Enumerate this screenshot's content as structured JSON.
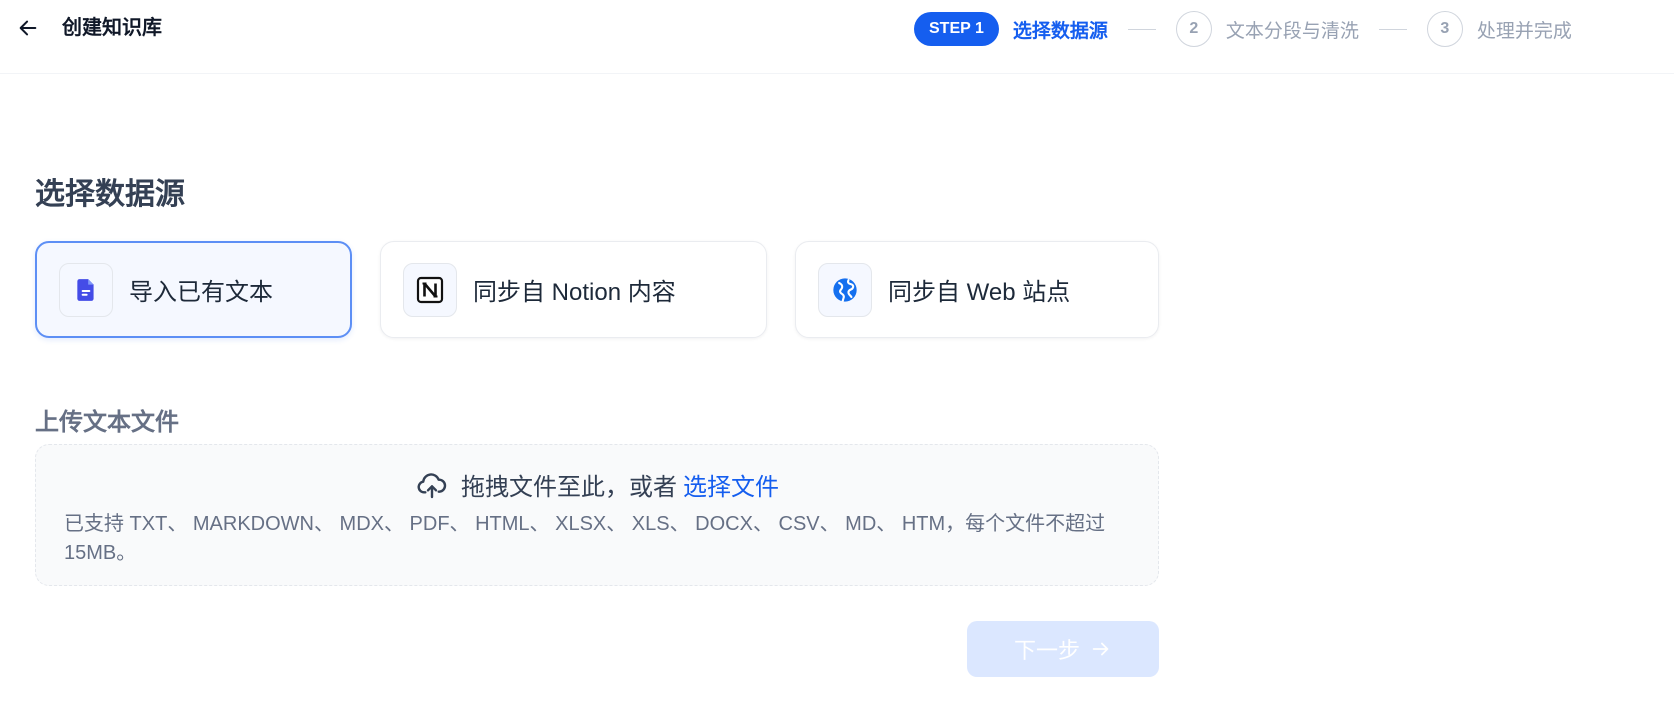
{
  "header": {
    "title": "创建知识库",
    "steps": [
      {
        "badge": "STEP 1",
        "label": "选择数据源",
        "state": "current"
      },
      {
        "badge": "2",
        "label": "文本分段与清洗",
        "state": "pending"
      },
      {
        "badge": "3",
        "label": "处理并完成",
        "state": "pending"
      }
    ]
  },
  "main": {
    "section_title": "选择数据源",
    "sources": [
      {
        "label": "导入已有文本",
        "icon": "file-text-icon",
        "selected": true
      },
      {
        "label": "同步自 Notion 内容",
        "icon": "notion-icon",
        "selected": false
      },
      {
        "label": "同步自 Web 站点",
        "icon": "globe-icon",
        "selected": false
      }
    ],
    "upload": {
      "title": "上传文本文件",
      "drop_text": "拖拽文件至此，或者",
      "select_link": "选择文件",
      "hint": "已支持 TXT、 MARKDOWN、 MDX、 PDF、 HTML、 XLSX、 XLS、 DOCX、 CSV、 MD、 HTM，每个文件不超过 15MB。"
    },
    "next_button": {
      "label": "下一步",
      "enabled": false
    }
  },
  "colors": {
    "accent": "#155eef",
    "muted": "#98a2b3",
    "disabled_button": "#dbe7ff"
  }
}
